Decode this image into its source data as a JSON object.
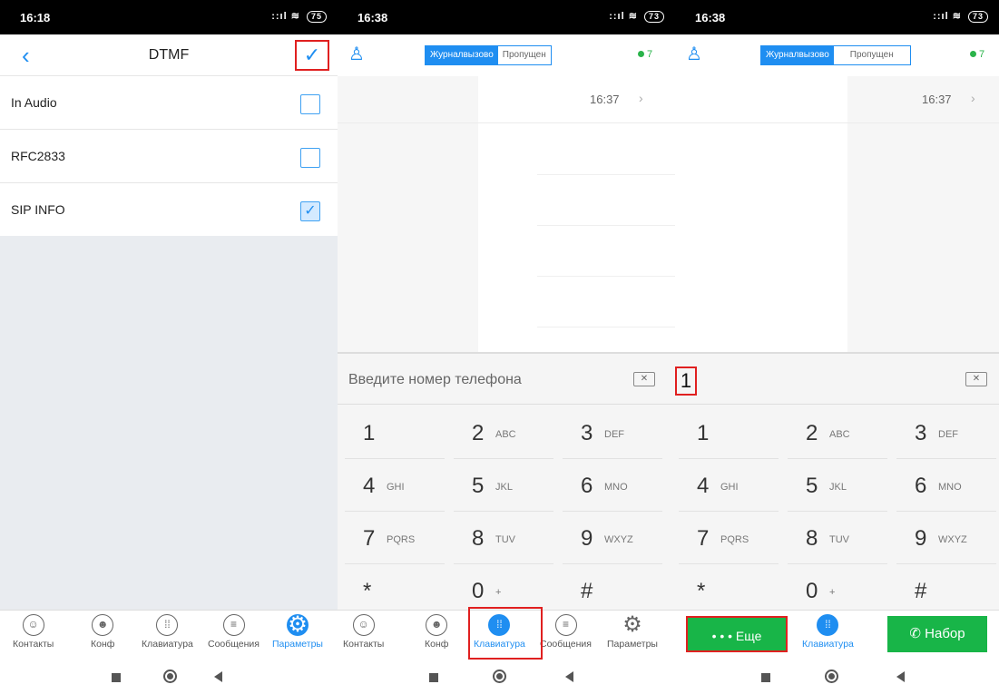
{
  "colors": {
    "accent": "#1f8ef1",
    "green": "#18b548",
    "highlight": "#e02020",
    "panel_bg": "#e9ecf0"
  },
  "panel1": {
    "status": {
      "time": "16:18",
      "battery": "75"
    },
    "title": "DTMF",
    "back_icon": "chevron-left-icon",
    "confirm_icon": "checkmark-icon",
    "confirm_glyph": "✓",
    "rows": [
      {
        "label": "In Audio",
        "checked": false
      },
      {
        "label": "RFC2833",
        "checked": false
      },
      {
        "label": "SIP INFO",
        "checked": true
      }
    ],
    "nav": [
      {
        "label": "Контакты",
        "icon": "contact-icon"
      },
      {
        "label": "Конф",
        "icon": "conference-icon"
      },
      {
        "label": "Клавиатура",
        "icon": "keypad-icon"
      },
      {
        "label": "Сообщения",
        "icon": "message-icon"
      },
      {
        "label": "Параметры",
        "icon": "gear-icon",
        "active": true
      }
    ]
  },
  "panel2": {
    "status": {
      "time": "16:38",
      "battery": "73"
    },
    "tabs": {
      "log": "Журналвызово",
      "missed": "Пропущен"
    },
    "count": "7",
    "log_time": "16:37",
    "placeholder": "Введите номер телефона",
    "keys": [
      {
        "d": "1",
        "l": ""
      },
      {
        "d": "2",
        "l": "ABC"
      },
      {
        "d": "3",
        "l": "DEF"
      },
      {
        "d": "4",
        "l": "GHI"
      },
      {
        "d": "5",
        "l": "JKL"
      },
      {
        "d": "6",
        "l": "MNO"
      },
      {
        "d": "7",
        "l": "PQRS"
      },
      {
        "d": "8",
        "l": "TUV"
      },
      {
        "d": "9",
        "l": "WXYZ"
      },
      {
        "d": "*",
        "l": ""
      },
      {
        "d": "0",
        "l": "+"
      },
      {
        "d": "#",
        "l": ""
      }
    ],
    "nav": [
      {
        "label": "Контакты",
        "icon": "contact-icon"
      },
      {
        "label": "Конф",
        "icon": "conference-icon"
      },
      {
        "label": "Клавиатура",
        "icon": "keypad-icon",
        "active": true
      },
      {
        "label": "Сообщения",
        "icon": "message-icon"
      },
      {
        "label": "Параметры",
        "icon": "gear-icon"
      }
    ]
  },
  "panel3": {
    "status": {
      "time": "16:38",
      "battery": "73"
    },
    "tabs": {
      "log": "Журналвызово",
      "missed": "Пропущен"
    },
    "count": "7",
    "log_time": "16:37",
    "number": "1",
    "more_label": "• • • Еще",
    "keypad_label": "Клавиатура",
    "dial_label": "Набор"
  }
}
